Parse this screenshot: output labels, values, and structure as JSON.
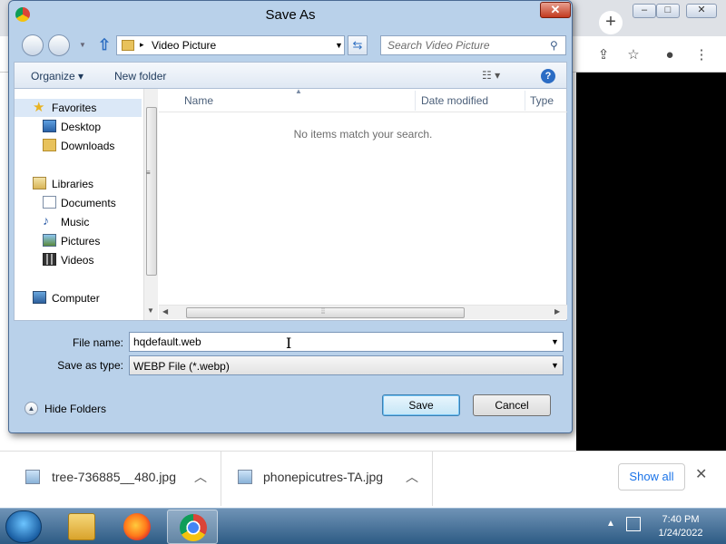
{
  "dialog": {
    "title": "Save As",
    "close_symbol": "✕",
    "address": {
      "crumb_arrow": "▸",
      "location": "Video Picture",
      "dropdown": "▼"
    },
    "search": {
      "placeholder": "Search Video Picture",
      "icon": "search-icon"
    },
    "toolbar": {
      "organize": "Organize ▾",
      "new_folder": "New folder",
      "view": "☷ ▾",
      "help": "?"
    },
    "nav_pane": {
      "favorites": {
        "label": "Favorites",
        "items": [
          "Desktop",
          "Downloads"
        ]
      },
      "libraries": {
        "label": "Libraries",
        "items": [
          "Documents",
          "Music",
          "Pictures",
          "Videos"
        ]
      },
      "computer": {
        "label": "Computer"
      }
    },
    "file_list": {
      "columns": [
        "Name",
        "Date modified",
        "Type"
      ],
      "empty_message": "No items match your search."
    },
    "file_name": {
      "label": "File name:",
      "value": "hqdefault.web"
    },
    "save_as_type": {
      "label": "Save as type:",
      "value": "WEBP File (*.webp)"
    },
    "hide_folders": "Hide Folders",
    "buttons": {
      "save": "Save",
      "cancel": "Cancel"
    }
  },
  "downloads": {
    "items": [
      {
        "name": "tree-736885__480.jpg"
      },
      {
        "name": "phonepicutres-TA.jpg"
      }
    ],
    "show_all": "Show all",
    "close": "✕"
  },
  "taskbar": {
    "apps": [
      "explorer-icon",
      "firefox-icon",
      "chrome-icon"
    ],
    "clock": {
      "time": "7:40 PM",
      "date": "1/24/2022"
    }
  },
  "colors": {
    "dialog_frame": "#b9d1ea",
    "accent_blue": "#1a73e8",
    "close_red": "#c2391e",
    "taskbar": "#2d5b84"
  }
}
